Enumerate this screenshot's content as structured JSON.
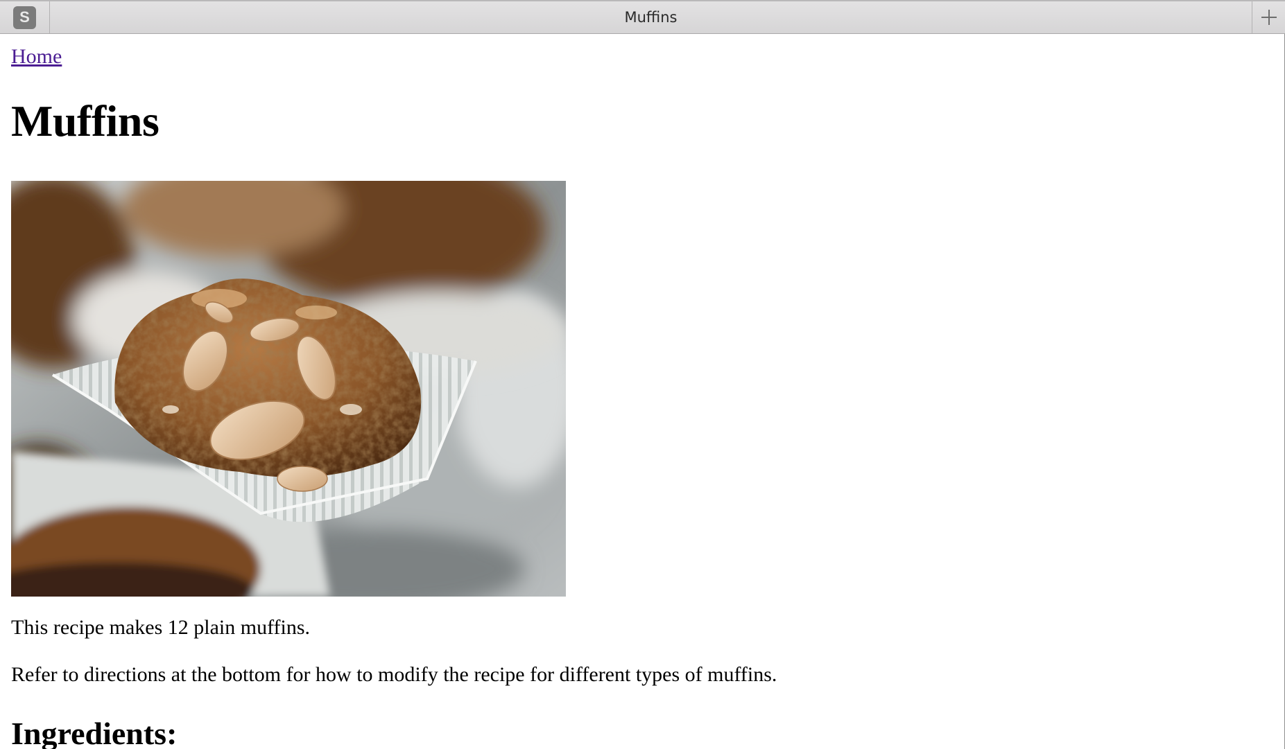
{
  "browser": {
    "pinned_tab_letter": "S",
    "active_tab_title": "Muffins"
  },
  "page": {
    "home_link": "Home",
    "title": "Muffins",
    "hero_image_icon": "muffin-photo",
    "intro_paragraphs": [
      "This recipe makes 12 plain muffins.",
      "Refer to directions at the bottom for how to modify the recipe for different types of muffins."
    ],
    "ingredients_heading": "Ingredients:"
  },
  "colors": {
    "link_visited": "#4b1d93",
    "tabbar_bg": "#dedddf",
    "text": "#000000"
  }
}
